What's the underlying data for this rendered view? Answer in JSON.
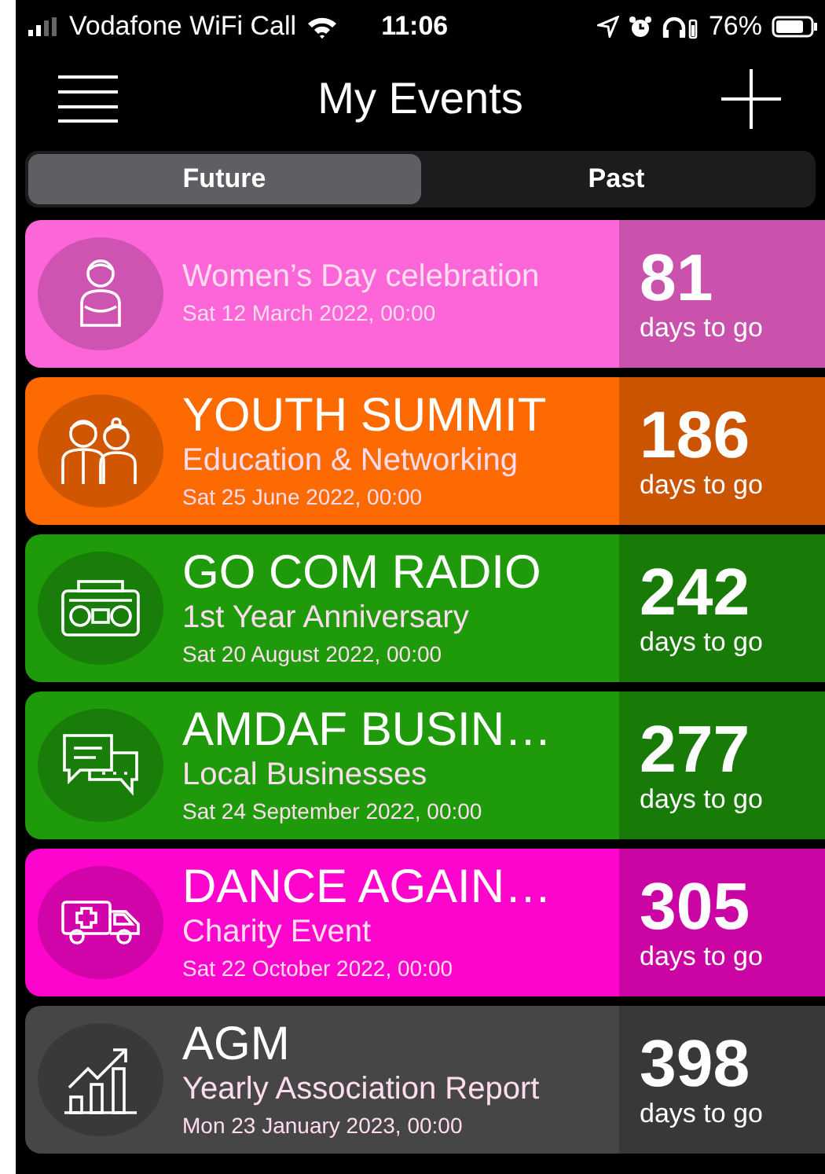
{
  "status_bar": {
    "carrier": "Vodafone WiFi Call",
    "time": "11:06",
    "battery": "76%"
  },
  "nav": {
    "title": "My Events"
  },
  "tabs": [
    {
      "label": "Future",
      "selected": true
    },
    {
      "label": "Past",
      "selected": false
    }
  ],
  "events": [
    {
      "kind": "woman",
      "subtitle": "Women’s Day celebration",
      "date": "Sat 12 March 2022, 00:00",
      "days": "81",
      "days_label": "days to go",
      "color": "#fd66d8"
    },
    {
      "kind": "couple",
      "title": "YOUTH SUMMIT",
      "subtitle": "Education & Networking",
      "date": "Sat 25 June 2022, 00:00",
      "days": "186",
      "days_label": "days to go",
      "color": "#fe6a02"
    },
    {
      "kind": "radio",
      "title": "GO COM RADIO",
      "subtitle": "1st Year Anniversary",
      "date": "Sat 20 August 2022, 00:00",
      "days": "242",
      "days_label": "days to go",
      "color": "#1e9a0b"
    },
    {
      "kind": "chat",
      "title": "AMDAF BUSIN…",
      "subtitle": "Local Businesses",
      "date": "Sat 24 September 2022, 00:00",
      "days": "277",
      "days_label": "days to go",
      "color": "#1e9a0b"
    },
    {
      "kind": "ambulance",
      "title": "DANCE AGAIN…",
      "subtitle": "Charity Event",
      "date": "Sat 22 October 2022, 00:00",
      "days": "305",
      "days_label": "days to go",
      "color": "#fe05cd"
    },
    {
      "kind": "chart",
      "title": "AGM",
      "subtitle": "Yearly Association Report",
      "date": "Mon 23 January 2023, 00:00",
      "days": "398",
      "days_label": "days to go",
      "color": "#464646"
    }
  ]
}
